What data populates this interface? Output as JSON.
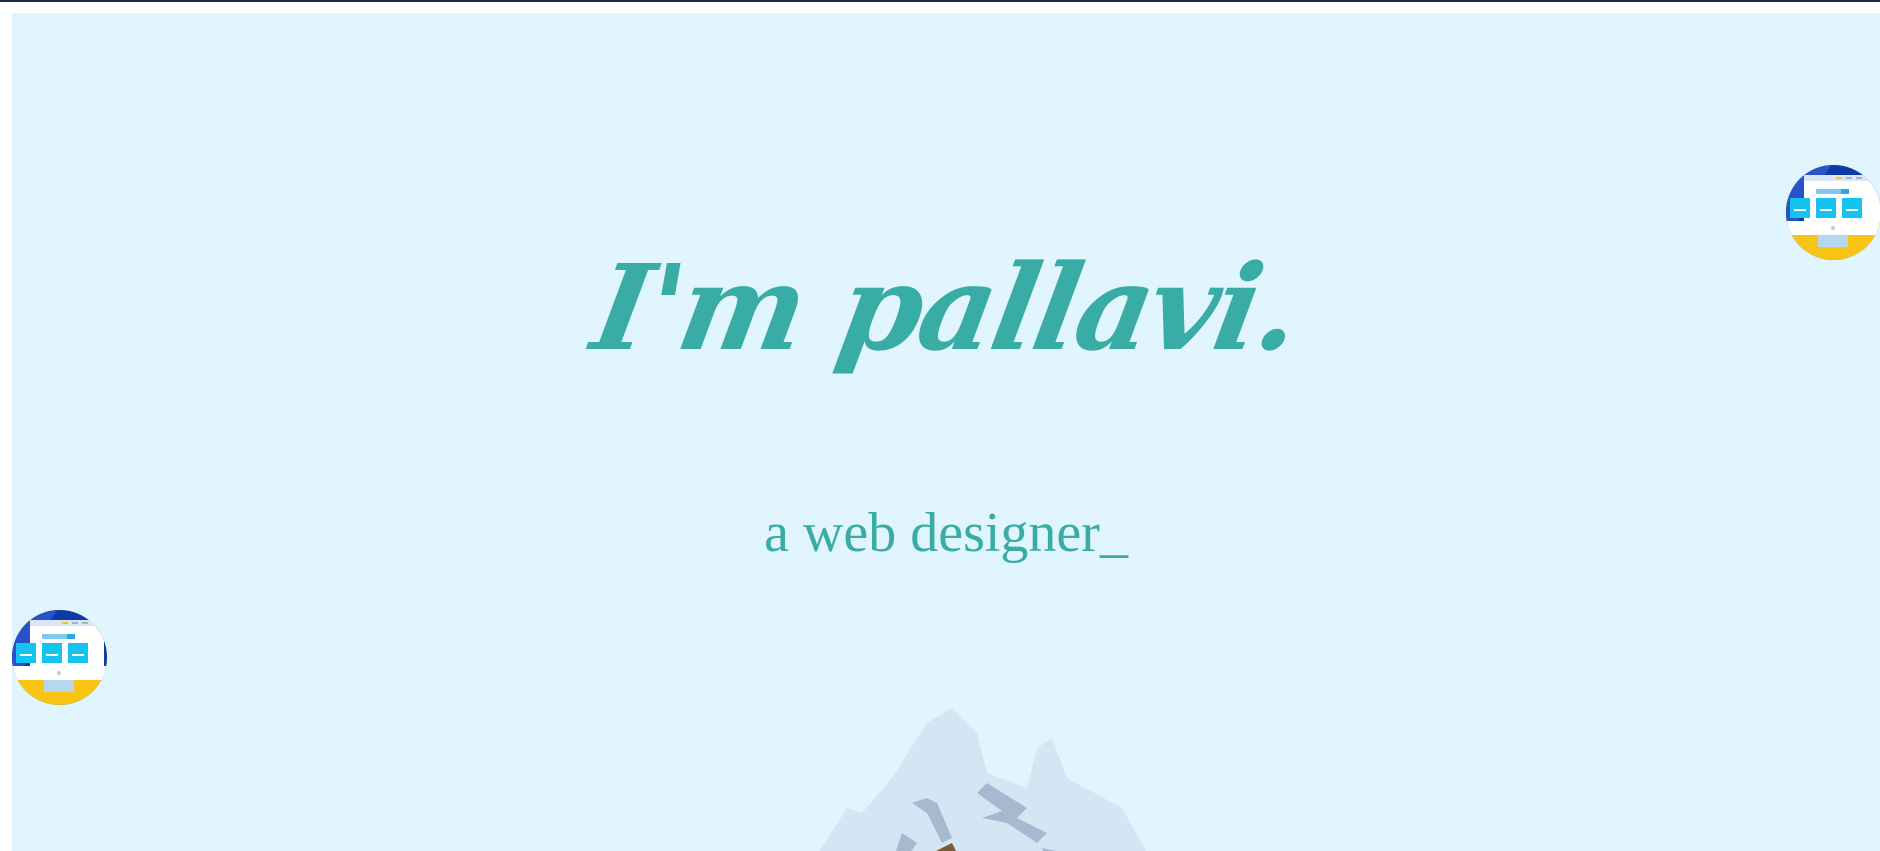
{
  "hero": {
    "heading": "I'm pallavi.",
    "subtitle_text": "a web designer",
    "cursor": "_"
  },
  "decorations": {
    "left_badge_icon": "desktop-website-icon",
    "right_badge_icon": "desktop-website-icon",
    "mountain_icon": "snowy-mountain-icon"
  },
  "colors": {
    "background": "#e0f5fd",
    "accent": "#3aaca6",
    "top_border": "#1b2a4a",
    "badge_blue": "#0f3aa7",
    "badge_yellow": "#f9c514"
  }
}
